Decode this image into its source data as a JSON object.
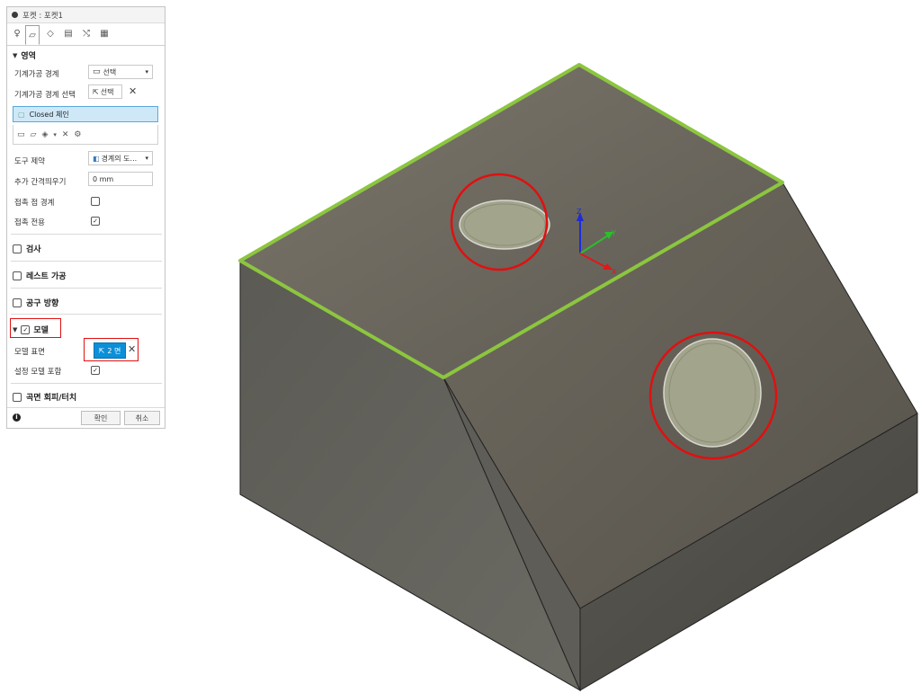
{
  "window": {
    "title": "포켓 : 포켓1"
  },
  "tabs": [
    {
      "icon": "tool-icon",
      "glyph": "♀"
    },
    {
      "icon": "geometry-icon",
      "glyph": "▱"
    },
    {
      "icon": "heights-icon",
      "glyph": "◇"
    },
    {
      "icon": "passes-icon",
      "glyph": "▤"
    },
    {
      "icon": "linking-icon",
      "glyph": "⤭"
    },
    {
      "icon": "shaft-icon",
      "glyph": "▦"
    }
  ],
  "sections": {
    "region": {
      "title": "영역",
      "machining_boundary_label": "기계가공 경계",
      "machining_boundary_value": "선택",
      "boundary_select_label": "기계가공 경계 선택",
      "boundary_select_value": "선택",
      "chain_label": "Closed 체인",
      "tool_containment_label": "도구 제약",
      "tool_containment_value": "경계의 도...",
      "extra_offset_label": "추가 간격띄우기",
      "extra_offset_value": "0 mm",
      "contact_point_label": "접촉 점 경계",
      "contact_only_label": "접촉 전용"
    },
    "inspection": {
      "title": "검사"
    },
    "rest_machining": {
      "title": "레스트 가공"
    },
    "tool_orientation": {
      "title": "공구 방향"
    },
    "model": {
      "title": "모델",
      "surface_label": "모델 표면",
      "surface_value": "2 면",
      "include_setup_label": "설정 모델 포함"
    },
    "avoid": {
      "title": "곡면 회피/터치"
    }
  },
  "buttons": {
    "ok": "확인",
    "cancel": "취소"
  },
  "axes": {
    "z": "Z",
    "y": "Y",
    "x": "X"
  },
  "colors": {
    "accent_blue": "#0c8fd8",
    "highlight_red": "#e01010",
    "edge_green": "#8cc63f",
    "top_face": "#6e6a60",
    "front_face": "#5e5c55",
    "slope_face": "#6b665c",
    "right_face": "#55534d",
    "hole_fill": "#a3a48c"
  }
}
